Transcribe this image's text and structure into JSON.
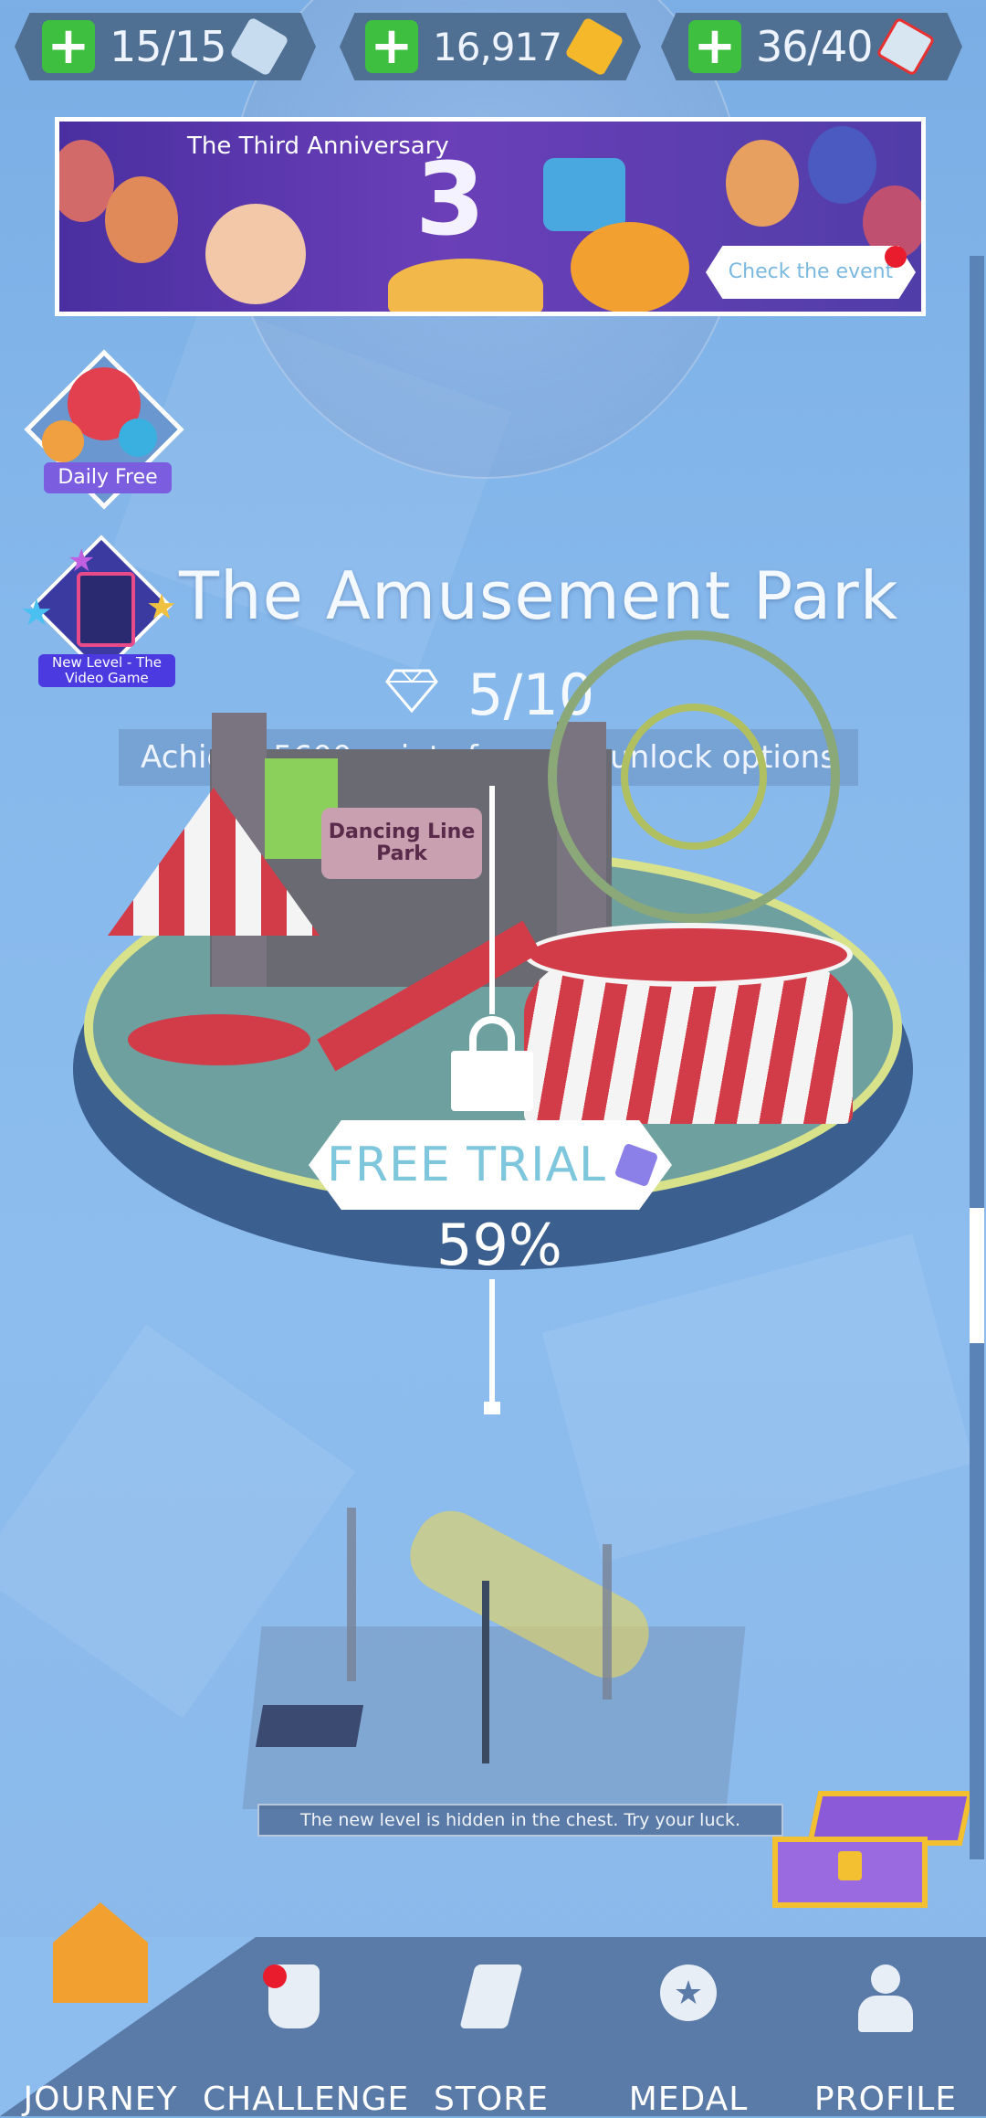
{
  "resources": {
    "energy": "15/15",
    "gold": "16,917",
    "gems": "36/40"
  },
  "banner": {
    "title": "The Third Anniversary",
    "anniversary_number": "3",
    "cta": "Check the event"
  },
  "daily_free": {
    "label": "Daily Free"
  },
  "new_level": {
    "label": "New Level - The Video Game"
  },
  "level": {
    "title": "The Amusement Park",
    "gems_progress": "5/10",
    "unlock_message": "Achieve 5600 points for more unlock options",
    "sign": "Dancing Line Park",
    "free_trial": "FREE TRIAL",
    "percent": "59%"
  },
  "chest_message": "The new level is hidden in the chest. Try your luck.",
  "nav": [
    {
      "label": "JOURNEY",
      "icon": "house-icon"
    },
    {
      "label": "CHALLENGE",
      "icon": "trophy-icon"
    },
    {
      "label": "STORE",
      "icon": "store-icon"
    },
    {
      "label": "MEDAL",
      "icon": "medal-icon"
    },
    {
      "label": "PROFILE",
      "icon": "profile-icon"
    }
  ],
  "colors": {
    "background": "#86b8ec",
    "plus": "#3fbf3f",
    "notification": "#e81c2c",
    "nav_bar": "#5a7aa8"
  }
}
